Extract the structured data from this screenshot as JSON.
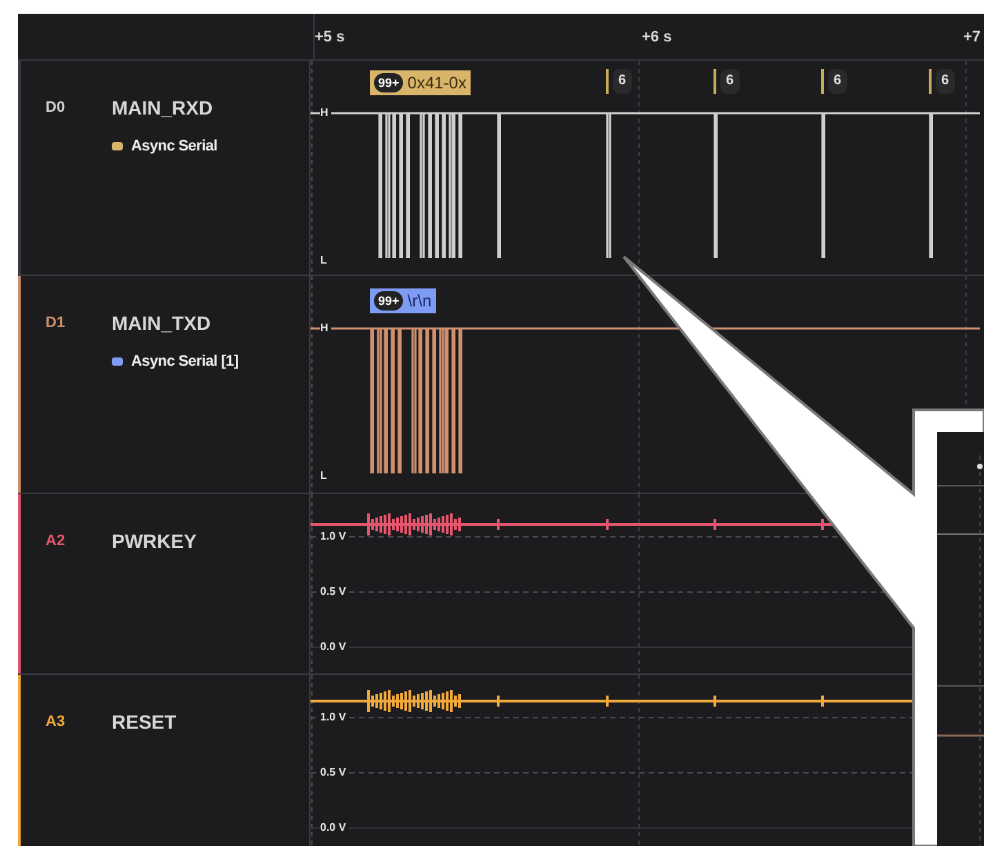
{
  "time_axis": {
    "ticks": [
      "+5 s",
      "+6 s",
      "+7"
    ]
  },
  "channels": [
    {
      "id": "D0",
      "name": "MAIN_RXD",
      "kind": "digital",
      "color": "#cfcfcf",
      "analyzer": {
        "label": "Async Serial",
        "color": "#d9b56a"
      },
      "bubble": {
        "count": "99+",
        "text": "0x41-0x"
      },
      "markers": [
        "6",
        "6",
        "6",
        "6"
      ],
      "levels": [
        "H",
        "L"
      ]
    },
    {
      "id": "D1",
      "name": "MAIN_TXD",
      "kind": "digital",
      "color": "#d0906e",
      "analyzer": {
        "label": "Async Serial [1]",
        "color": "#7f9cf5"
      },
      "bubble": {
        "count": "99+",
        "text": "\\r\\n"
      },
      "levels": [
        "H",
        "L"
      ]
    },
    {
      "id": "A2",
      "name": "PWRKEY",
      "kind": "analog",
      "color": "#e5566e",
      "levels": [
        "1.0 V",
        "0.5 V",
        "0.0 V"
      ]
    },
    {
      "id": "A3",
      "name": "RESET",
      "kind": "analog",
      "color": "#f2a93b",
      "levels": [
        "1.0 V",
        "0.5 V",
        "0.0 V"
      ]
    }
  ]
}
